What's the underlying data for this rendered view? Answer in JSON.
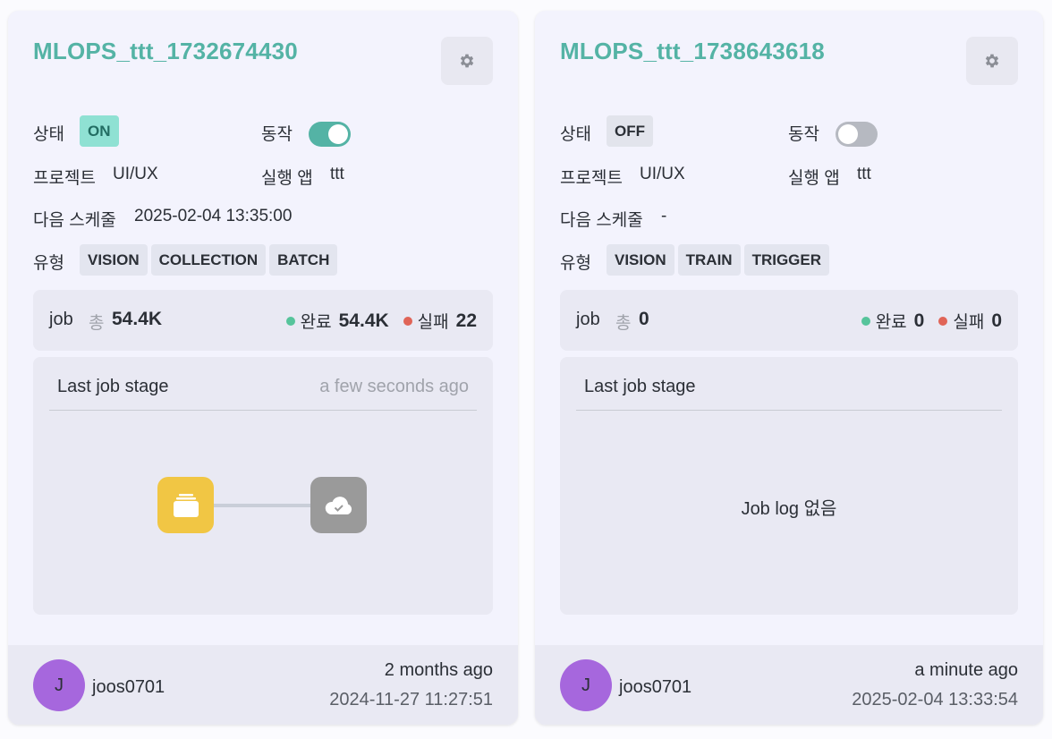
{
  "labels": {
    "status": "상태",
    "action": "동작",
    "project": "프로젝트",
    "app": "실행 앱",
    "next_schedule": "다음 스케줄",
    "type": "유형",
    "job": "job",
    "total": "총",
    "done": "완료",
    "failed": "실패",
    "last_job_stage": "Last job stage"
  },
  "cards": [
    {
      "title": "MLOPS_ttt_1732674430",
      "status": "ON",
      "action_on": true,
      "project": "UI/UX",
      "app": "ttt",
      "next_schedule": "2025-02-04 13:35:00",
      "types": [
        "VISION",
        "COLLECTION",
        "BATCH"
      ],
      "job_total": "54.4K",
      "job_done": "54.4K",
      "job_failed": "22",
      "stage_time": "a few seconds ago",
      "stage_nodes": [
        "collection-icon",
        "cloud-check-icon"
      ],
      "no_log_text": "",
      "avatar_initial": "J",
      "user": "joos0701",
      "created_relative": "2 months ago",
      "created_at": "2024-11-27 11:27:51"
    },
    {
      "title": "MLOPS_ttt_1738643618",
      "status": "OFF",
      "action_on": false,
      "project": "UI/UX",
      "app": "ttt",
      "next_schedule": "-",
      "types": [
        "VISION",
        "TRAIN",
        "TRIGGER"
      ],
      "job_total": "0",
      "job_done": "0",
      "job_failed": "0",
      "stage_time": "",
      "stage_nodes": [],
      "no_log_text": "Job log 없음",
      "avatar_initial": "J",
      "user": "joos0701",
      "created_relative": "a minute ago",
      "created_at": "2025-02-04 13:33:54"
    }
  ],
  "colors": {
    "accent": "#54b3a5",
    "node_yellow": "#f1c644",
    "node_gray": "#9a9a9a",
    "avatar": "#a667dd",
    "done_dot": "#56c49b",
    "fail_dot": "#e06457"
  }
}
